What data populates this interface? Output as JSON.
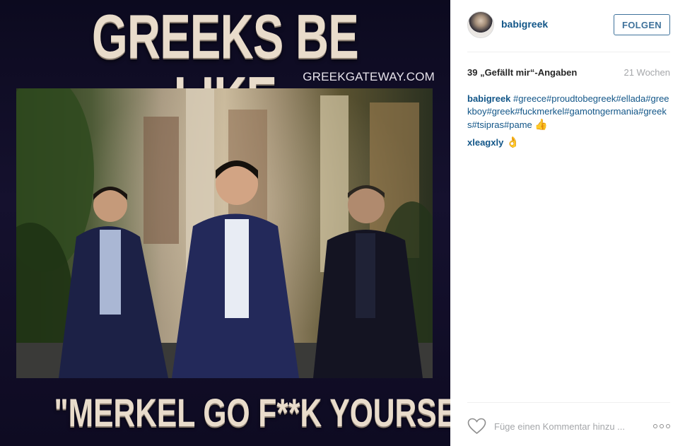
{
  "media": {
    "top_text": "GREEKS BE LIKE",
    "watermark": "GREEKGATEWAY.COM",
    "bottom_text": "\"MERKEL GO F**K YOURSELF\""
  },
  "post": {
    "username": "babigreek",
    "follow_label": "FOLGEN",
    "likes_text": "39 „Gefällt mir“-Angaben",
    "age_text": "21 Wochen",
    "comments": [
      {
        "user": "babigreek",
        "hashtags": [
          "#greece",
          "#proudtobegreek",
          "#ellada",
          "#greekboy",
          "#greek",
          "#fuckmerkel",
          "#gamotngermania",
          "#greeks",
          "#tsipras",
          "#pame"
        ],
        "emoji": "👍",
        "emoji_icon": "thumbs-up-icon"
      },
      {
        "user": "xleagxly",
        "hashtags": [],
        "emoji": "👌",
        "emoji_icon": "ok-hand-icon"
      }
    ],
    "comment_placeholder": "Füge einen Kommentar hinzu ..."
  },
  "icons": {
    "like": "heart-icon",
    "more": "more-options-icon"
  },
  "colors": {
    "link": "#125688",
    "button_border": "#3f729b",
    "muted": "#a5a7aa",
    "meme_text": "#e9dccb",
    "media_bg": "#120f28"
  }
}
